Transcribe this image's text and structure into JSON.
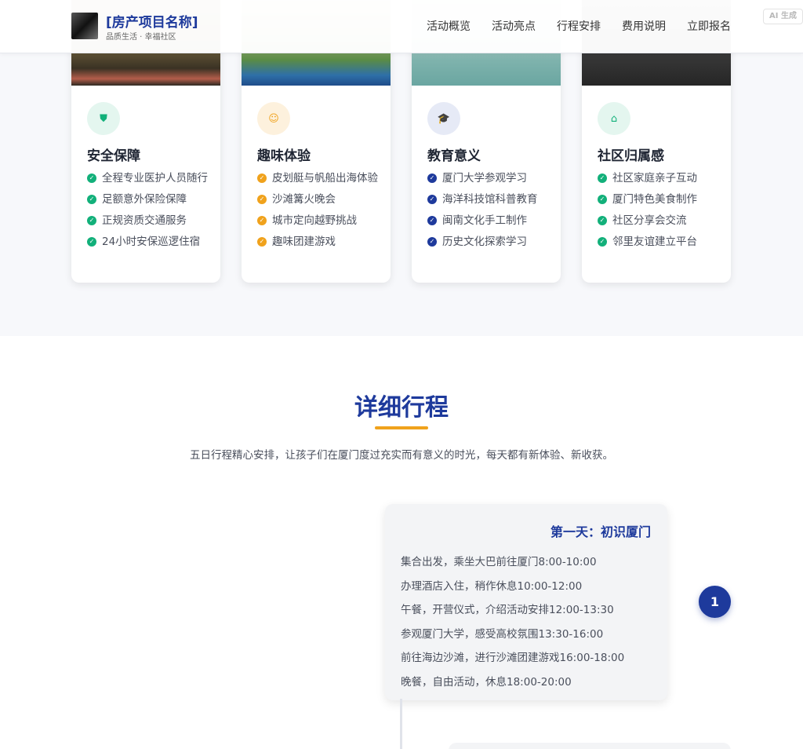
{
  "header": {
    "brand_name": "[房产项目名称]",
    "brand_tagline": "品质生活 · 幸福社区",
    "nav": [
      "活动概览",
      "活动亮点",
      "行程安排",
      "费用说明",
      "立即报名"
    ],
    "ai_badge": "AI 生成"
  },
  "features": [
    {
      "title": "安全保障",
      "icon": "shield-icon",
      "icon_glyph": "⛊",
      "accent": "#12b07a",
      "icon_bg": "#e4f6ef",
      "items": [
        "全程专业医护人员随行",
        "足额意外保险保障",
        "正规资质交通服务",
        "24小时安保巡逻住宿"
      ]
    },
    {
      "title": "趣味体验",
      "icon": "smile-icon",
      "icon_glyph": "☺",
      "accent": "#f0a21c",
      "icon_bg": "#fdf1dd",
      "items": [
        "皮划艇与帆船出海体验",
        "沙滩篝火晚会",
        "城市定向越野挑战",
        "趣味团建游戏"
      ]
    },
    {
      "title": "教育意义",
      "icon": "graduation-cap-icon",
      "icon_glyph": "🎓",
      "accent": "#1e3a9c",
      "icon_bg": "#e6eaf6",
      "items": [
        "厦门大学参观学习",
        "海洋科技馆科普教育",
        "闽南文化手工制作",
        "历史文化探索学习"
      ]
    },
    {
      "title": "社区归属感",
      "icon": "home-icon",
      "icon_glyph": "⌂",
      "accent": "#12b07a",
      "icon_bg": "#e4f6ef",
      "items": [
        "社区家庭亲子互动",
        "厦门特色美食制作",
        "社区分享会交流",
        "邻里友谊建立平台"
      ]
    }
  ],
  "itinerary": {
    "title": "详细行程",
    "subtitle": "五日行程精心安排，让孩子们在厦门度过充实而有意义的时光，每天都有新体验、新收获。",
    "days": [
      {
        "number": "1",
        "title": "第一天：初识厦门",
        "items": [
          "集合出发，乘坐大巴前往厦门8:00-10:00",
          "办理酒店入住，稍作休息10:00-12:00",
          "午餐，开营仪式，介绍活动安排12:00-13:30",
          "参观厦门大学，感受高校氛围13:30-16:00",
          "前往海边沙滩，进行沙滩团建游戏16:00-18:00",
          "晚餐，自由活动，休息18:00-20:00"
        ]
      }
    ]
  },
  "colors": {
    "primary": "#1e3a9c",
    "accent_orange": "#f0a21c",
    "accent_green": "#12b07a"
  }
}
